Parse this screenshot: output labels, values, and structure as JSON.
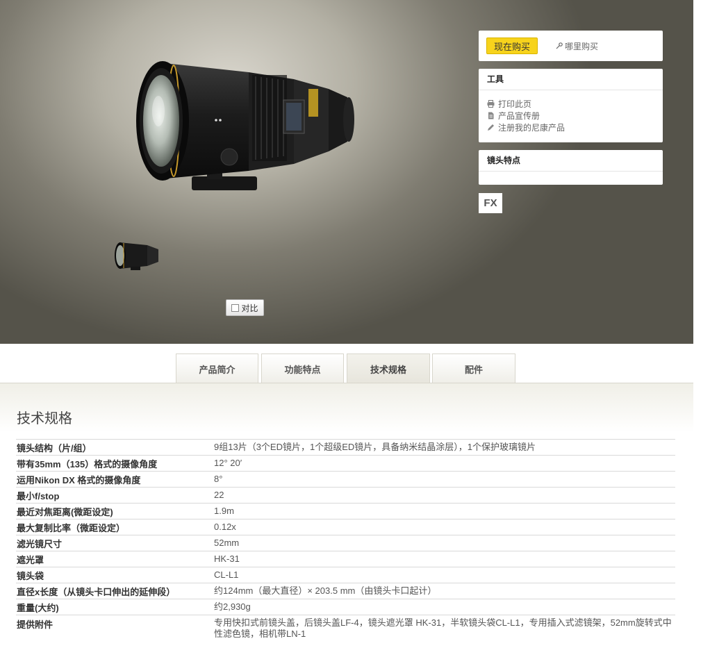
{
  "hero": {
    "compare_label": "对比"
  },
  "buy": {
    "buy_now": "现在购买",
    "where_to_buy": "哪里购买"
  },
  "tools": {
    "title": "工具",
    "items": [
      {
        "icon": "printer-icon",
        "label": "打印此页"
      },
      {
        "icon": "document-icon",
        "label": "产品宣传册"
      },
      {
        "icon": "pencil-icon",
        "label": "注册我的尼康产品"
      }
    ]
  },
  "features": {
    "title": "镜头特点",
    "badge": "FX"
  },
  "tabs": [
    {
      "label": "产品简介",
      "active": false
    },
    {
      "label": "功能特点",
      "active": false
    },
    {
      "label": "技术规格",
      "active": true
    },
    {
      "label": "配件",
      "active": false
    }
  ],
  "specs": {
    "title": "技术规格",
    "rows": [
      {
        "label": "镜头结构（片/组）",
        "value": "9组13片（3个ED镜片，1个超级ED镜片，具备纳米结晶涂层），1个保护玻璃镜片"
      },
      {
        "label": "带有35mm（135）格式的摄像角度",
        "value": "12° 20′"
      },
      {
        "label": "运用Nikon DX 格式的摄像角度",
        "value": "8°"
      },
      {
        "label": "最小f/stop",
        "value": "22"
      },
      {
        "label": "最近对焦距离(微距设定)",
        "value": "1.9m"
      },
      {
        "label": "最大复制比率（微距设定）",
        "value": "0.12x"
      },
      {
        "label": "滤光镜尺寸",
        "value": "52mm"
      },
      {
        "label": "遮光罩",
        "value": "HK-31"
      },
      {
        "label": "镜头袋",
        "value": "CL-L1"
      },
      {
        "label": "直径x长度（从镜头卡口伸出的延伸段）",
        "value": "约124mm（最大直径）× 203.5 mm（由镜头卡口起计）"
      },
      {
        "label": "重量(大约)",
        "value": "约2,930g"
      },
      {
        "label": "提供附件",
        "value": "专用快扣式前镜头盖，后镜头盖LF-4，镜头遮光罩 HK-31，半软镜头袋CL-L1，专用插入式滤镜架，52mm旋转式中性滤色镜，相机带LN-1"
      }
    ]
  }
}
